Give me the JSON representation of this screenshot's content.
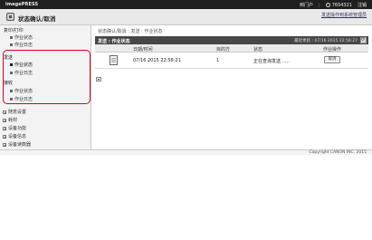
{
  "header": {
    "brand": "imagePRESS",
    "links": [
      "到门户",
      "7654321",
      "注销"
    ]
  },
  "subheader": {
    "title": "状态确认/取消",
    "settings_link": "发送操作到系统管理员"
  },
  "sidebar": {
    "groups": [
      {
        "label": "复印/打印",
        "items": [
          "作业状态",
          "作业日志"
        ]
      },
      {
        "label": "发送",
        "items": [
          "作业状态",
          "作业日志"
        ]
      },
      {
        "label": "接收",
        "items": [
          "作业状态",
          "作业日志"
        ]
      }
    ],
    "collapsed": [
      "随意设置",
      "耗材",
      "设备功能",
      "设备信息",
      "设备读数器"
    ],
    "active": "发送 / 作业状态"
  },
  "main": {
    "breadcrumb": "状态确认/取消 : 发送 : 作业状态",
    "section_label": "发送 : 作业状态",
    "last_updated": "最近更新 : 07/16 2015 22:56:27",
    "columns": [
      "日期/时间",
      "目的方",
      "状态",
      "作业操作"
    ],
    "rows": [
      {
        "datetime": "07/16 2015 22:56:21",
        "destinations": "1",
        "status": "正在查询发送……",
        "action": "取消"
      }
    ]
  },
  "footer": {
    "copyright": "Copyright CANON INC. 2015"
  }
}
